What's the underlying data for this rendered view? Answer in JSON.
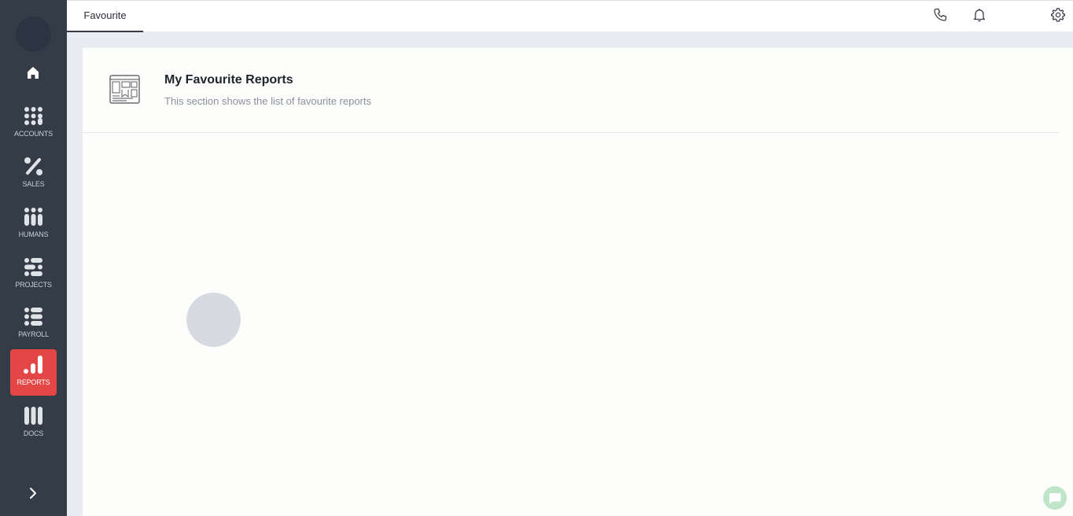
{
  "sidebar": {
    "items": [
      {
        "label": "ACCOUNTS",
        "icon": "accounts-icon"
      },
      {
        "label": "SALES",
        "icon": "sales-icon"
      },
      {
        "label": "HUMANS",
        "icon": "humans-icon"
      },
      {
        "label": "PROJECTS",
        "icon": "projects-icon"
      },
      {
        "label": "PAYROLL",
        "icon": "payroll-icon"
      },
      {
        "label": "REPORTS",
        "icon": "reports-icon",
        "active": true
      },
      {
        "label": "DOCS",
        "icon": "docs-icon"
      }
    ]
  },
  "header": {
    "tabs": [
      {
        "label": "Favourite",
        "active": true
      }
    ],
    "icons": [
      "phone-icon",
      "bell-icon",
      "gear-icon"
    ]
  },
  "main": {
    "title": "My Favourite Reports",
    "subtitle": "This section shows the list of favourite reports"
  },
  "colors": {
    "sidebar_bg": "#343c47",
    "active_accent": "#e44545",
    "page_bg": "#e9ecf0"
  }
}
